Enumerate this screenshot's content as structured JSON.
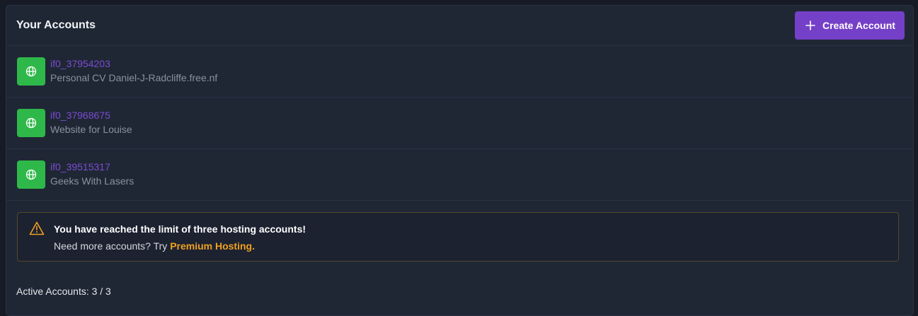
{
  "header": {
    "title": "Your Accounts",
    "create_button_label": "Create Account",
    "create_icon": "plus-icon"
  },
  "accounts": [
    {
      "id": "if0_37954203",
      "label": "Personal CV Daniel-J-Radcliffe.free.nf",
      "icon": "globe-icon"
    },
    {
      "id": "if0_37968675",
      "label": "Website for Louise",
      "icon": "globe-icon"
    },
    {
      "id": "if0_39515317",
      "label": "Geeks With Lasers",
      "icon": "globe-icon"
    }
  ],
  "alert": {
    "icon": "warning-icon",
    "title": "You have reached the limit of three hosting accounts!",
    "text_prefix": "Need more accounts? Try ",
    "link_label": "Premium Hosting."
  },
  "footer": {
    "text": "Active Accounts: 3 / 3"
  },
  "colors": {
    "accent": "#7540c8",
    "account_icon_bg": "#2fb84a",
    "warning": "#f0a020",
    "card_bg": "#1f2735"
  }
}
